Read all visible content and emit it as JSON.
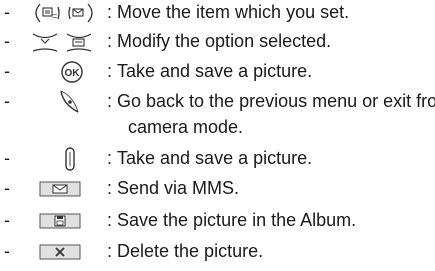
{
  "items": [
    {
      "dash": "-",
      "colon": ":",
      "icon": "nav-left-right-key-icon",
      "text": "Move the item which you set."
    },
    {
      "dash": "-",
      "colon": ":",
      "icon": "nav-up-down-key-icon",
      "text": "Modify the option selected."
    },
    {
      "dash": "-",
      "colon": ":",
      "icon": "ok-key-icon",
      "text": "Take and save a picture."
    },
    {
      "dash": "-",
      "colon": ":",
      "icon": "end-key-icon",
      "text": "Go back to the previous menu or exit from",
      "text2": "camera mode."
    },
    {
      "dash": "-",
      "colon": ":",
      "icon": "side-camera-key-icon",
      "text": "Take and save a picture."
    },
    {
      "dash": "-",
      "colon": ":",
      "icon": "envelope-key-icon",
      "text": "Send via MMS."
    },
    {
      "dash": "-",
      "colon": ":",
      "icon": "save-key-icon",
      "text": "Save the picture in the Album."
    },
    {
      "dash": "-",
      "colon": ":",
      "icon": "delete-key-icon",
      "text": "Delete the picture."
    }
  ]
}
